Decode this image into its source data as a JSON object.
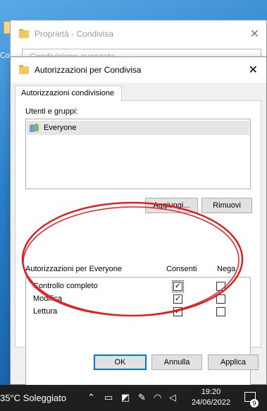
{
  "desktop": {
    "label_fragment": "Co"
  },
  "back_window": {
    "title": "Proprietà - Condivisa",
    "tab_label": "Condivisione avanzata",
    "close_glyph": "✕"
  },
  "dialog": {
    "title": "Autorizzazioni per Condivisa",
    "close_glyph": "✕",
    "tab_label": "Autorizzazioni condivisione",
    "users_label": "Utenti e gruppi:",
    "users": [
      {
        "name": "Everyone",
        "icon": "group-users-icon"
      }
    ],
    "add_button": "Aggiungi...",
    "remove_button": "Rimuovi",
    "permissions_header": "Autorizzazioni per Everyone",
    "allow_header": "Consenti",
    "deny_header": "Nega",
    "permissions": [
      {
        "name": "Controllo completo",
        "allow": true,
        "deny": false
      },
      {
        "name": "Modifica",
        "allow": true,
        "deny": false
      },
      {
        "name": "Lettura",
        "allow": true,
        "deny": false
      }
    ],
    "ok_button": "OK",
    "cancel_button": "Annulla",
    "apply_button": "Applica"
  },
  "annotation": {
    "color": "#e02020",
    "shape": "ellipse"
  },
  "taskbar": {
    "weather": "35°C Soleggiato",
    "time": "19:20",
    "date": "24/06/2022",
    "notification_count": "9",
    "background": "#1f1f1f"
  }
}
